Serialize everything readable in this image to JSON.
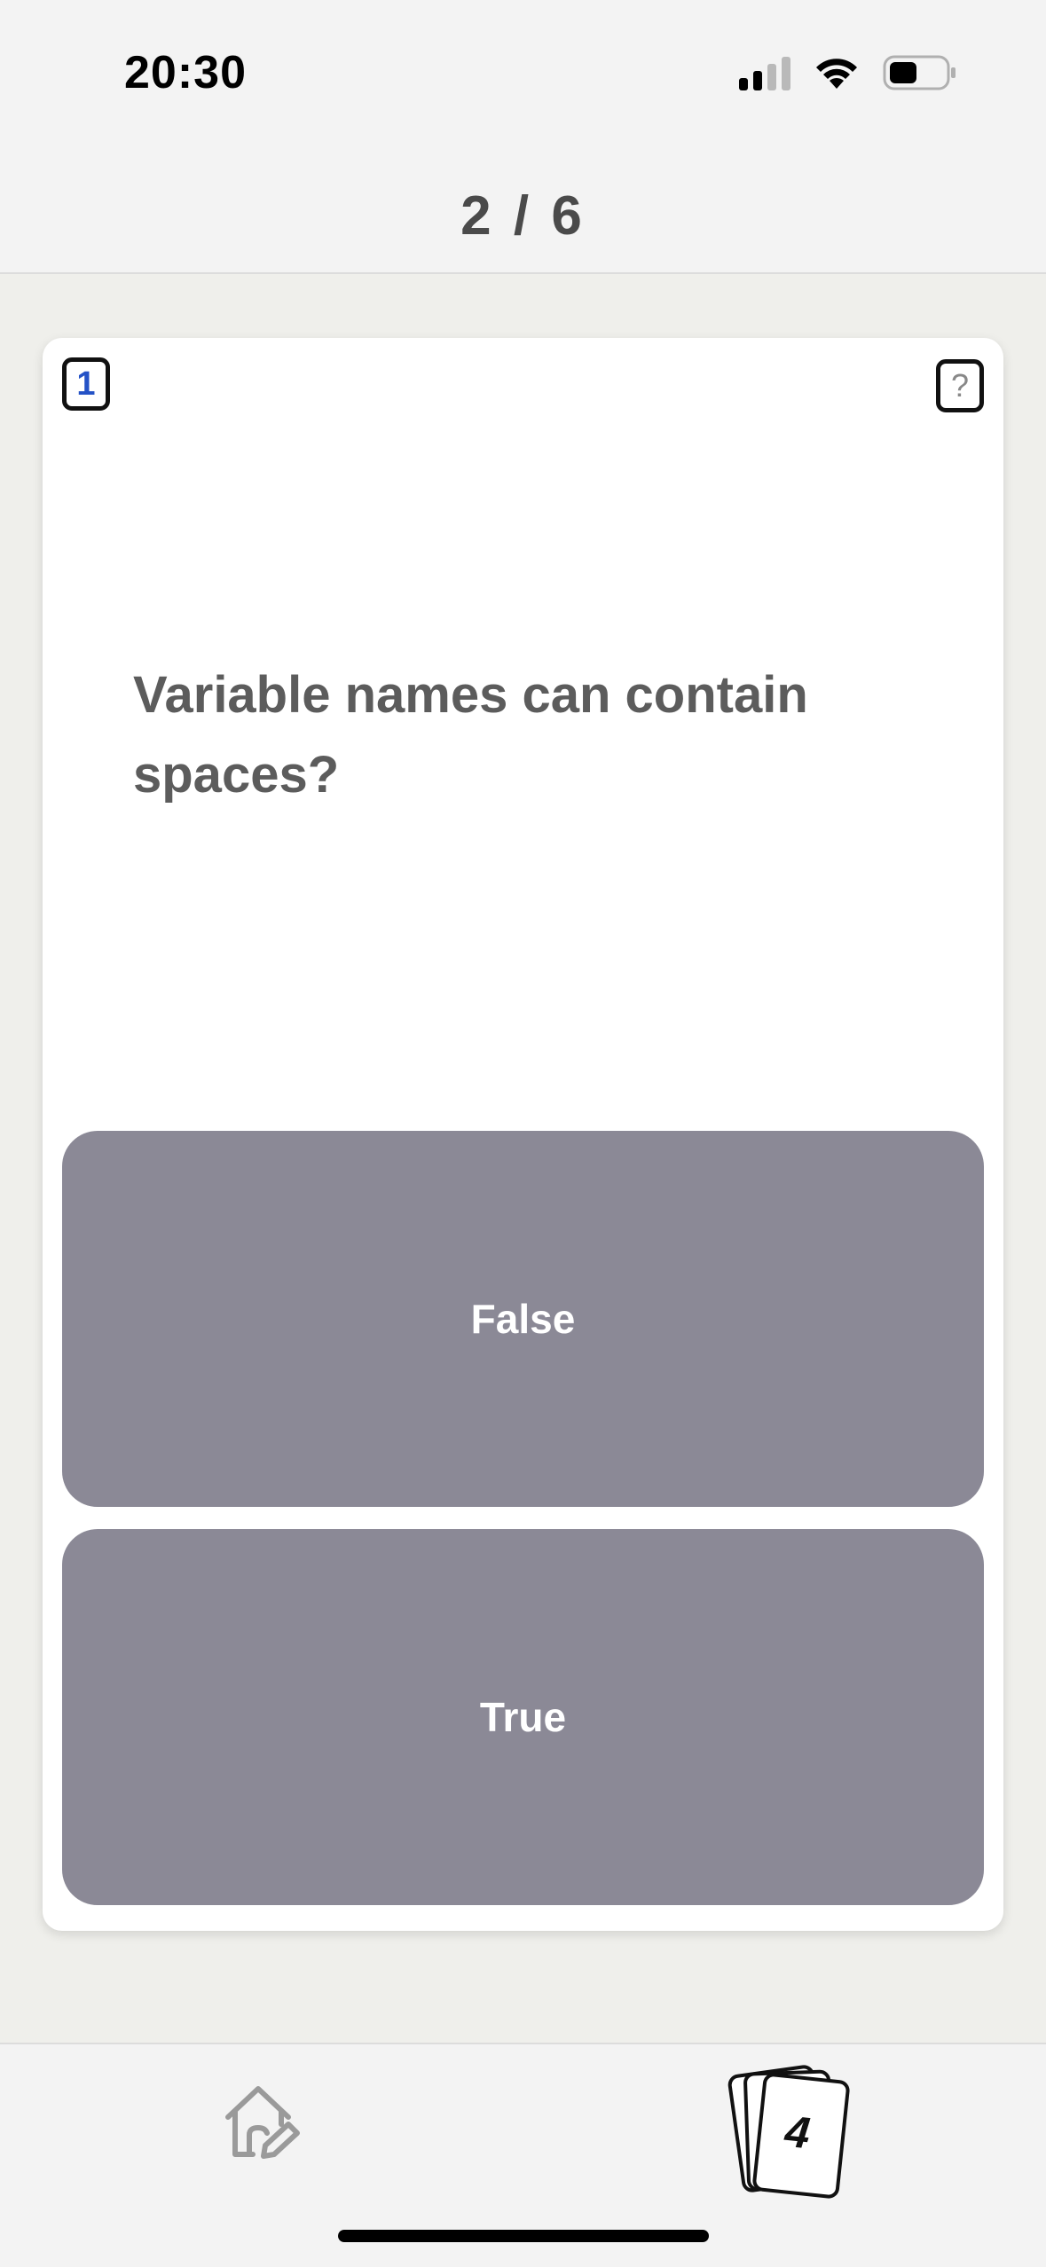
{
  "status_bar": {
    "time": "20:30",
    "signal_icon": "cellular-signal-icon",
    "wifi_icon": "wifi-icon",
    "battery_icon": "battery-icon"
  },
  "header": {
    "progress": "2 / 6"
  },
  "card": {
    "number_badge": "1",
    "help_badge": "?",
    "question": "Variable names can contain spaces?",
    "answers": [
      {
        "label": "False"
      },
      {
        "label": "True"
      }
    ],
    "answer_color": "#8b8996"
  },
  "tabbar": {
    "home_icon": "home-edit-icon",
    "deck_icon": "card-deck-icon",
    "deck_count": "4"
  },
  "colors": {
    "accent_number": "#2452c6",
    "background": "#efefeb",
    "card": "#ffffff"
  }
}
